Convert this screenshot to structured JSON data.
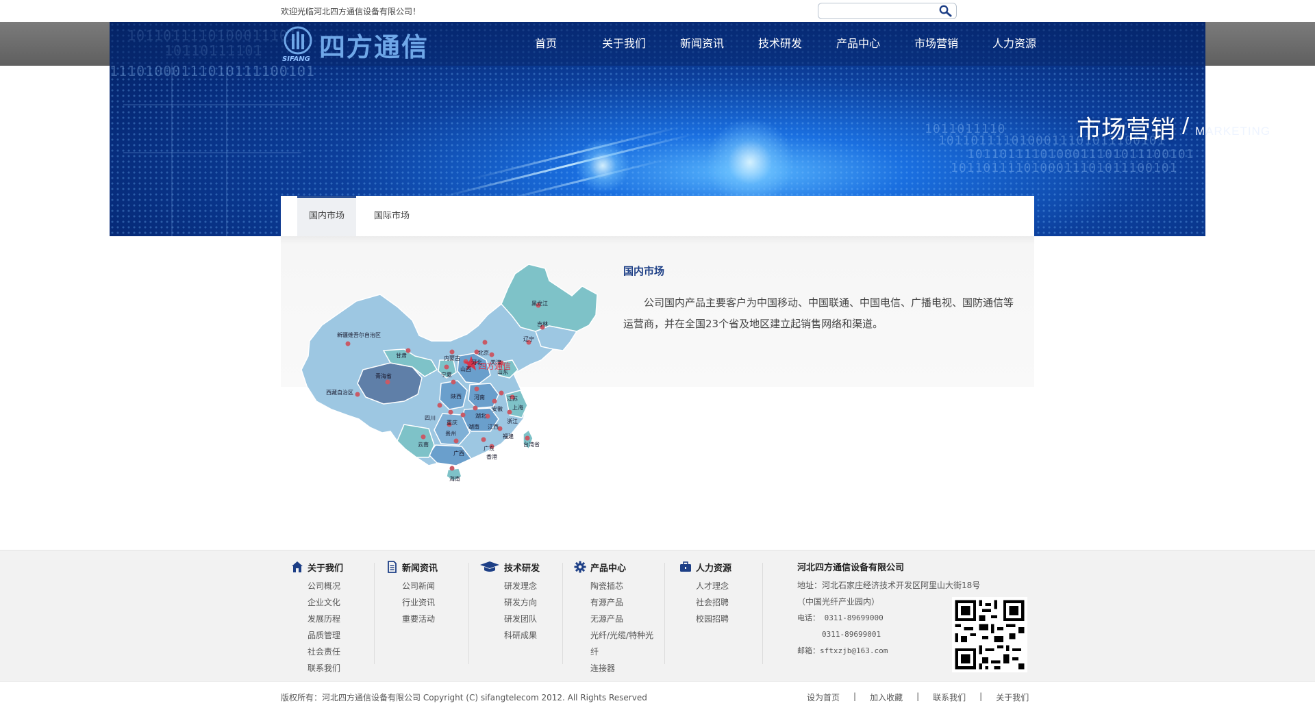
{
  "topbar": {
    "welcome": "欢迎光临河北四方通信设备有限公司！",
    "search_placeholder": ""
  },
  "logo": {
    "name": "四方通信",
    "en": "SIFANG"
  },
  "nav": [
    "首页",
    "关于我们",
    "新闻资讯",
    "技术研发",
    "产品中心",
    "市场营销",
    "人力资源"
  ],
  "banner": {
    "title": "市场营销",
    "slash": "/",
    "subtitle": "MARKETING",
    "binary_lines": [
      "1011011110100011101",
      "10110111101",
      "11101000111010111100101",
      "1011011110",
      "1011011110100011101011100101",
      "1011011110100011101011100101",
      "1011011110100011101011100101"
    ]
  },
  "tabs": {
    "active": "国内市场",
    "other": "国际市场"
  },
  "content": {
    "title": "国内市场",
    "body": "公司国内产品主要客户为中国移动、中国联通、中国电信、广播电视、国防通信等运营商，并在全国23个省及地区建立起销售网络和渠道。"
  },
  "map": {
    "regions": [
      "新疆维吾尔自治区",
      "西藏自治区",
      "青海省",
      "甘肃",
      "内蒙古",
      "黑龙江",
      "吉林",
      "辽宁",
      "北京",
      "天津",
      "河北",
      "山西",
      "山东",
      "宁夏",
      "陕西",
      "河南",
      "江苏",
      "上海",
      "安徽",
      "湖北",
      "四川",
      "重庆",
      "湖南",
      "江西",
      "浙江",
      "福建",
      "贵州",
      "云南",
      "广西",
      "广东",
      "香港",
      "台湾省",
      "海南"
    ],
    "company_label": "四方通信"
  },
  "footer": {
    "columns": [
      {
        "title": "关于我们",
        "icon": "home-icon",
        "items": [
          "公司概况",
          "企业文化",
          "发展历程",
          "品质管理",
          "社会责任",
          "联系我们"
        ]
      },
      {
        "title": "新闻资讯",
        "icon": "document-icon",
        "items": [
          "公司新闻",
          "行业资讯",
          "重要活动"
        ]
      },
      {
        "title": "技术研发",
        "icon": "graduation-cap-icon",
        "items": [
          "研发理念",
          "研发方向",
          "研发团队",
          "科研成果"
        ]
      },
      {
        "title": "产品中心",
        "icon": "gear-icon",
        "items": [
          "陶瓷插芯",
          "有源产品",
          "无源产品",
          "光纤/光缆/特种光",
          "纤",
          "连接器"
        ]
      },
      {
        "title": "人力资源",
        "icon": "briefcase-icon",
        "items": [
          "人才理念",
          "社会招聘",
          "校园招聘"
        ]
      }
    ],
    "company": {
      "name": "河北四方通信设备有限公司",
      "address": "地址：河北石家庄经济技术开发区阿里山大街18号",
      "address2": "（中国光纤产业园内）",
      "phone1": "电话：  0311-89699000",
      "phone2": "0311-89699001",
      "email": "邮箱：sftxzjb@163.com"
    },
    "copyright": "版权所有：河北四方通信设备有限公司 Copyright (C) sifangtelecom 2012. All Rights Reserved",
    "links": [
      "设为首页",
      "加入收藏",
      "联系我们",
      "关于我们"
    ],
    "link_sep": "|"
  },
  "colors": {
    "nav_bg": "#0a2a70",
    "accent": "#1d3f86",
    "footer_bg": "#f2f2f2"
  }
}
